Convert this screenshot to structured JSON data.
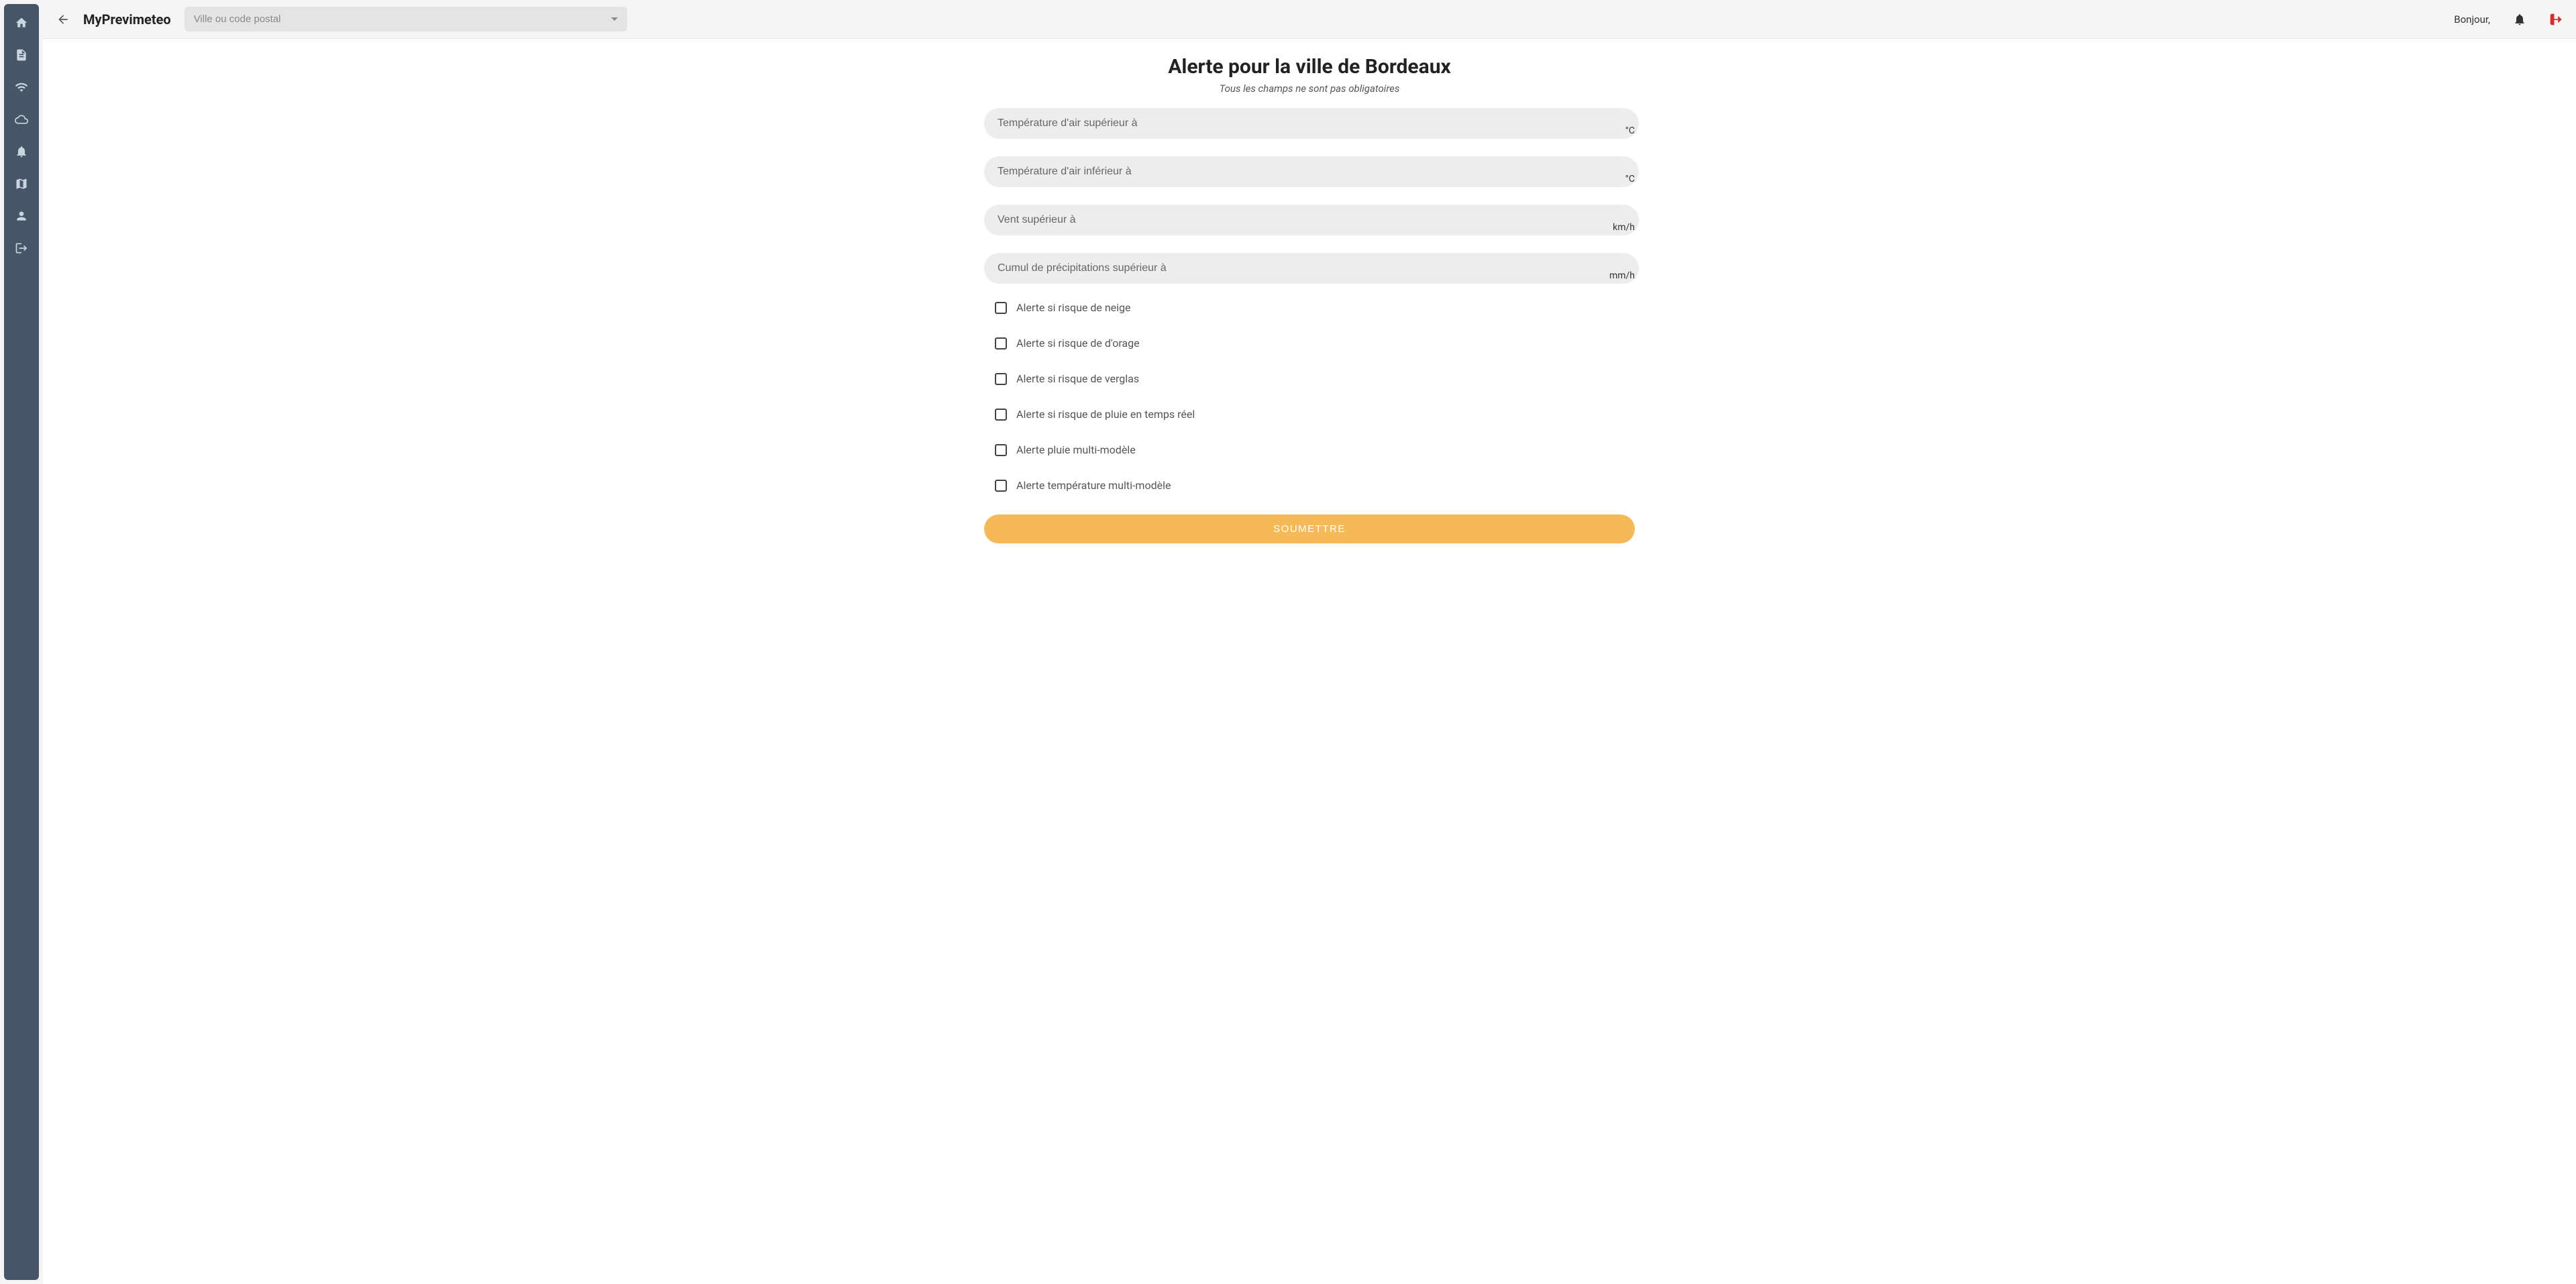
{
  "sidebar": {
    "items": [
      {
        "name": "home"
      },
      {
        "name": "document"
      },
      {
        "name": "wifi"
      },
      {
        "name": "cloud"
      },
      {
        "name": "bell"
      },
      {
        "name": "map"
      },
      {
        "name": "user"
      },
      {
        "name": "logout"
      }
    ]
  },
  "topbar": {
    "app_title": "MyPrevimeteo",
    "search_placeholder": "Ville ou code postal",
    "greeting": "Bonjour,"
  },
  "main": {
    "title": "Alerte pour la ville de Bordeaux",
    "subtitle": "Tous les champs ne sont pas obligatoires",
    "fields": [
      {
        "label": "Température d'air supérieur à",
        "unit": "°C"
      },
      {
        "label": "Température d'air inférieur à",
        "unit": "°C"
      },
      {
        "label": "Vent supérieur à",
        "unit": "km/h"
      },
      {
        "label": "Cumul de précipitations supérieur à",
        "unit": "mm/h"
      }
    ],
    "checkboxes": [
      "Alerte si risque de neige",
      "Alerte si risque de d'orage",
      "Alerte si risque de verglas",
      "Alerte si risque de pluie en temps réel",
      "Alerte pluie multi-modèle",
      "Alerte température multi-modèle"
    ],
    "submit_label": "SOUMETTRE"
  }
}
